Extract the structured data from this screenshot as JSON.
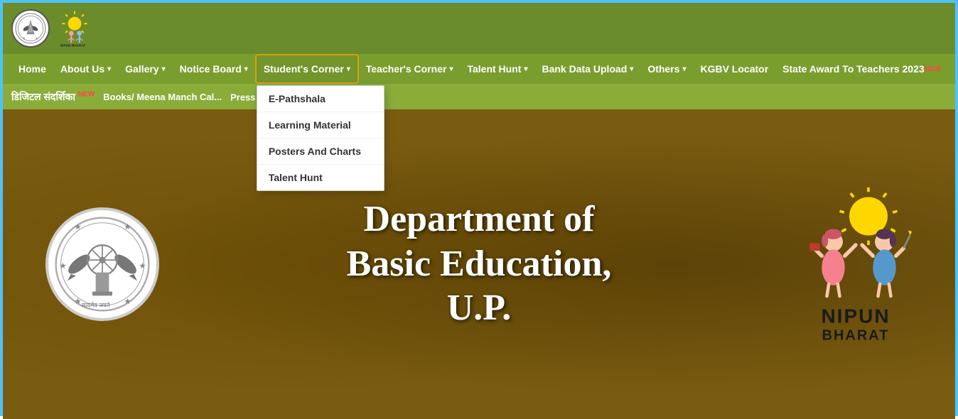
{
  "header": {
    "title": "Department of Basic Education, U.P."
  },
  "navbar": {
    "items": [
      {
        "label": "Home",
        "hasDropdown": false,
        "isNew": false
      },
      {
        "label": "About Us",
        "hasDropdown": true,
        "isNew": false
      },
      {
        "label": "Gallery",
        "hasDropdown": true,
        "isNew": false
      },
      {
        "label": "Notice Board",
        "hasDropdown": true,
        "isNew": false
      },
      {
        "label": "Student's Corner",
        "hasDropdown": true,
        "isNew": false,
        "active": true
      },
      {
        "label": "Teacher's Corner",
        "hasDropdown": true,
        "isNew": false
      },
      {
        "label": "Talent Hunt",
        "hasDropdown": true,
        "isNew": false
      },
      {
        "label": "Bank Data Upload",
        "hasDropdown": true,
        "isNew": false
      },
      {
        "label": "Others",
        "hasDropdown": true,
        "isNew": false
      },
      {
        "label": "KGBV Locator",
        "hasDropdown": false,
        "isNew": false
      },
      {
        "label": "State Award To Teachers 2023",
        "hasDropdown": false,
        "isNew": true
      }
    ]
  },
  "students_corner_dropdown": {
    "items": [
      {
        "label": "E-Pathshala"
      },
      {
        "label": "Learning Material"
      },
      {
        "label": "Posters And Charts"
      },
      {
        "label": "Talent Hunt"
      }
    ]
  },
  "secondary_nav": {
    "items": [
      {
        "label": "डिजिटल संदर्शिका",
        "isNew": true
      },
      {
        "label": "Books/ Meena Manch Cal..."
      },
      {
        "label": "Press Report",
        "isNew": true
      }
    ]
  },
  "hero": {
    "title_line1": "Department of",
    "title_line2": "Basic Education,",
    "title_line3": "U.P.",
    "nipun_text": "NIPUN",
    "nipun_sub": "BHARAT"
  },
  "badges": {
    "new_label": "NEW"
  }
}
